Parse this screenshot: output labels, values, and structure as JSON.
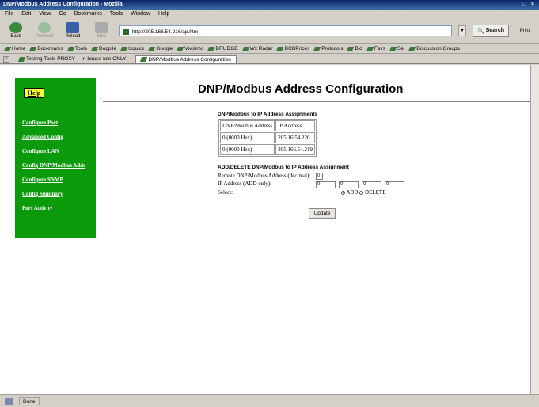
{
  "window": {
    "title": "DNP/Modbus Address Configuration - Mozilla",
    "controls": "_ □ ×"
  },
  "menu": [
    "File",
    "Edit",
    "View",
    "Go",
    "Bookmarks",
    "Tools",
    "Window",
    "Help"
  ],
  "nav": {
    "back": "Back",
    "forward": "Forward",
    "reload": "Reload",
    "stop": "Stop",
    "url": "http://205.166.54.216/ap.htm",
    "search": "Search",
    "print": "Print"
  },
  "bookmarks": [
    "Home",
    "Bookmarks",
    "Tools",
    "Dogpile",
    "Ixquick",
    "Google",
    "Vivisimo",
    "DRUDGE",
    "Wx Radar",
    "DCBPrices",
    "Protocols",
    "Bid",
    "Favs",
    "Sel",
    "Discussion Groups"
  ],
  "tabs": [
    "Testing Tools PROXY -- In-house use ONLY",
    "DNP/Modbus Address Configuration"
  ],
  "sidebar": {
    "help": "Help",
    "links": [
      "Configure Port",
      "Advanced Config",
      "Configure LAN",
      "Config DNP/Modbus Addr",
      "Configure SNMP",
      "Config Summary",
      "Port Activity"
    ]
  },
  "page": {
    "title": "DNP/Modbus Address Configuration",
    "assign_title": "DNP/Modbus to IP Address Assignments",
    "assign_headers": [
      "DNP/Modbus Address",
      "IP Address"
    ],
    "assign_rows": [
      [
        "0 (0000 Hex)",
        "205.16.54.220"
      ],
      [
        "0 (0000 Hex)",
        "205.166.54.219"
      ]
    ],
    "add_title": "ADD/DELETE DNP/Modbus to IP Address Assignment",
    "remote_label": "Remote DNP/Modbus Address (decimal):",
    "remote_value": "0",
    "ip_label": "IP Address (ADD only):",
    "ip_values": [
      "0",
      "0",
      "0",
      "0"
    ],
    "select_label": "Select:",
    "add_option": "ADD",
    "delete_option": "DELETE",
    "update_button": "Update"
  },
  "status": {
    "text": "Done"
  }
}
